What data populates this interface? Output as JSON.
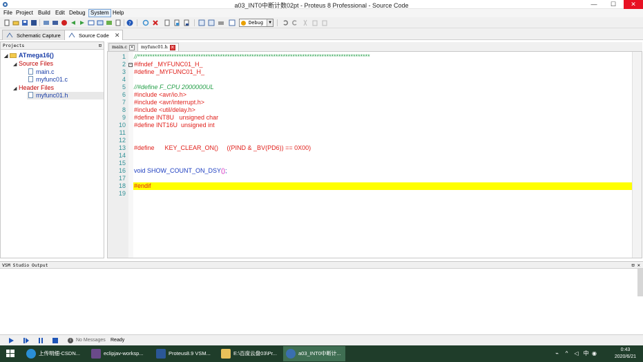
{
  "window": {
    "title": "a03_INT0中断计数02pt - Proteus 8 Professional - Source Code",
    "minimize": "—",
    "maximize": "☐",
    "close": "✕"
  },
  "menu": [
    "File",
    "Project",
    "Build",
    "Edit",
    "Debug",
    "System",
    "Help"
  ],
  "toolbar": {
    "build_config": "Debug"
  },
  "doc_tabs": [
    {
      "label": "Schematic Capture",
      "close": "✕"
    },
    {
      "label": "Source Code",
      "close": "✕"
    }
  ],
  "projects": {
    "header": "Projects",
    "pin": "⊡",
    "root": "ATmega16()",
    "groups": [
      {
        "label": "Source Files",
        "files": [
          "main.c",
          "myfunc01.c"
        ]
      },
      {
        "label": "Header Files",
        "files": [
          "myfunc01.h"
        ]
      }
    ]
  },
  "editor": {
    "tabs": [
      {
        "label": "main.c",
        "close": "×"
      },
      {
        "label": "myfunc01.h",
        "close": "×"
      }
    ],
    "line_numbers": [
      "1",
      "2",
      "3",
      "4",
      "5",
      "6",
      "7",
      "8",
      "9",
      "10",
      "11",
      "12",
      "13",
      "14",
      "15",
      "16",
      "17",
      "18",
      "19"
    ],
    "lines": {
      "l1": "//************************************************************************************************",
      "l2": "#ifndef _MYFUNC01_H_",
      "l3": "#define _MYFUNC01_H_",
      "l5": "//#define F_CPU 2000000UL",
      "l6": "#include <avr/io.h>",
      "l7": "#include <avr/interrupt.h>",
      "l8": "#include <util/delay.h>",
      "l9": "#define INT8U   unsigned char",
      "l10": "#define INT16U  unsigned int",
      "l13": "#define      KEY_CLEAR_ON()     ((PIND & _BV(PD6)) == 0X00)",
      "l16_a": "void SHOW_COUNT_ON_DSY",
      "l16_b": "()",
      "l16_c": ";",
      "l18": "#endif"
    }
  },
  "output": {
    "header": "VSM Studio Output",
    "controls": "⊡ ✕"
  },
  "status": {
    "messages": "No Messages",
    "ready": "Ready"
  },
  "taskbar": {
    "apps": [
      "上传明细-CSDN...",
      "eclipjav-worksp...",
      "Proteus8.9 VSM...",
      "E:\\百度云盘03\\Pr...",
      "a03_INT0中断计..."
    ],
    "tray_ime": "中",
    "time": "0:43",
    "date": "2020/6/21"
  },
  "colors": {
    "preprocessor": "#e0201b",
    "comment": "#27a04a",
    "identifier": "#1b3cc0",
    "paren": "#d11ab8",
    "current_line": "#ffff00",
    "line_number": "#2f8f95"
  }
}
